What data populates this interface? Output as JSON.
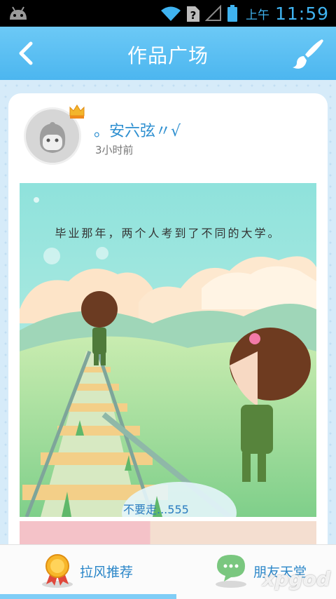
{
  "status_bar": {
    "ampm": "上午",
    "time": "11:59"
  },
  "header": {
    "title": "作品广场"
  },
  "post": {
    "username": "。安六弦〃√",
    "time_ago": "3小时前",
    "caption": "毕业那年，两个人考到了不同的大学。",
    "bubble_text": "不要走...555"
  },
  "bottom_nav": {
    "tabs": [
      {
        "label": "拉风推荐",
        "icon": "medal-icon",
        "active": true
      },
      {
        "label": "朋友天堂",
        "icon": "chat-bubble-icon",
        "active": false
      }
    ]
  },
  "watermark": "xpgod",
  "colors": {
    "accent": "#4cb6ef",
    "tab_label": "#2a86c8",
    "username": "#2d8fd0"
  }
}
